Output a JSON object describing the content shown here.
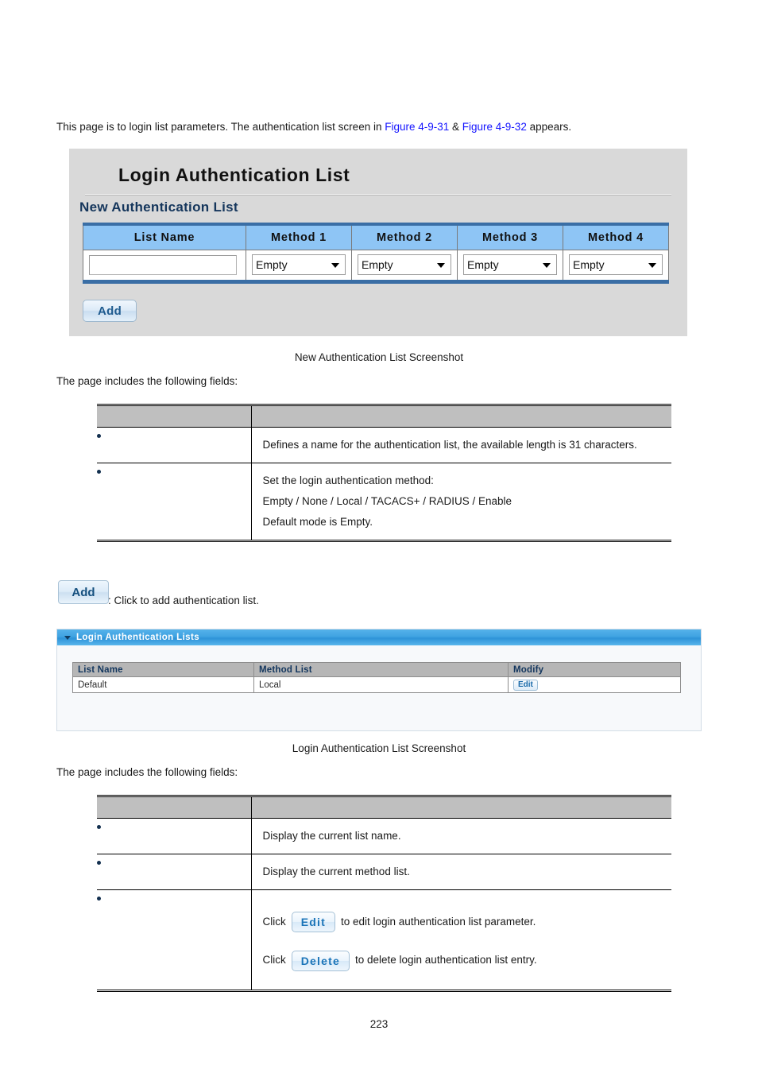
{
  "intro": {
    "text_before": "This page is to login list parameters. The authentication list screen in ",
    "figure_ref_1": "Figure 4-9-31",
    "text_mid": " & ",
    "figure_ref_2": "Figure 4-9-32",
    "text_after": " appears."
  },
  "screenshot1": {
    "title": "Login Authentication List",
    "subtitle": "New Authentication List",
    "table": {
      "headers": [
        "List Name",
        "Method 1",
        "Method 2",
        "Method 3",
        "Method 4"
      ],
      "row": {
        "list_name_value": "",
        "list_name_placeholder": "",
        "method1": "Empty",
        "method2": "Empty",
        "method3": "Empty",
        "method4": "Empty"
      }
    },
    "add_button": "Add"
  },
  "caption1": "New Authentication List Screenshot",
  "fields_note_1": "The page includes the following fields:",
  "desc_table_1": {
    "headers": [
      "",
      ""
    ],
    "rows": [
      {
        "label": "",
        "lines": [
          "Defines a name for the authentication list, the available length is 31 characters."
        ]
      },
      {
        "label": "",
        "lines": [
          "Set the login authentication method:",
          "Empty / None / Local / TACACS+ / RADIUS / Enable",
          "Default mode is Empty."
        ]
      }
    ]
  },
  "add_note": {
    "button": "Add",
    "text": ": Click to add authentication list."
  },
  "screenshot2": {
    "bar_title": "Login Authentication Lists",
    "table": {
      "headers": [
        "List Name",
        "Method List",
        "Modify"
      ],
      "rows": [
        {
          "list_name": "Default",
          "method_list": "Local",
          "modify": "Edit"
        }
      ]
    }
  },
  "caption2": "Login Authentication List Screenshot",
  "fields_note_2": "The page includes the following fields:",
  "desc_table_2": {
    "headers": [
      "",
      ""
    ],
    "rows": [
      {
        "label": "",
        "lines": [
          "Display the current list name."
        ]
      },
      {
        "label": "",
        "lines": [
          "Display the current method list."
        ]
      },
      {
        "label": "",
        "click_rows": [
          {
            "pre": "Click",
            "button": "Edit",
            "post": "to edit login authentication list parameter."
          },
          {
            "pre": "Click",
            "button": "Delete",
            "post": "to delete login authentication list entry."
          }
        ]
      }
    ]
  },
  "page_number": "223",
  "colors": {
    "figure_link": "#1414ff",
    "panel_bg": "#d9d9d9",
    "table_header_blue": "#8ec5f5",
    "table_border_blue": "#3a6ea5",
    "subtitle_navy": "#15365c",
    "bar_blue": "#3fa3e2",
    "list_header_gray": "#b6b6b6",
    "desc_header_gray": "#bfbfbf",
    "bullet_navy": "#13304f"
  }
}
